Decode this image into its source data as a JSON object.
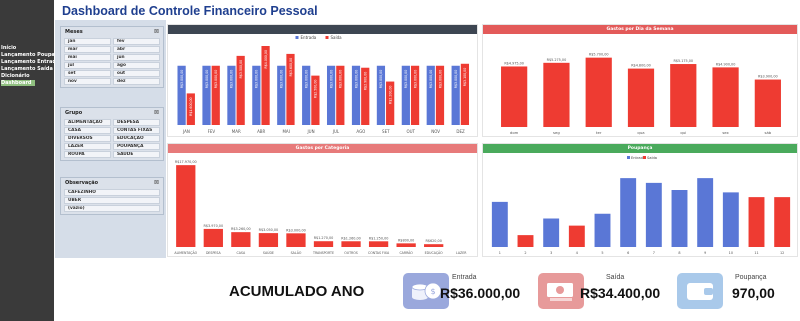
{
  "title": "Dashboard de Controle Financeiro Pessoal",
  "sidebar": {
    "items": [
      {
        "label": "Início",
        "active": false
      },
      {
        "label": "Lançamento Poupança",
        "active": false
      },
      {
        "label": "Lançamento Entrada",
        "active": false
      },
      {
        "label": "Lançamento Saída",
        "active": false
      },
      {
        "label": "Dicionário",
        "active": false
      },
      {
        "label": "Dashboard",
        "active": true
      }
    ]
  },
  "slicers": {
    "mes": {
      "title": "Meses",
      "items": [
        "jan",
        "fev",
        "mar",
        "abr",
        "mai",
        "jun",
        "jul",
        "ago",
        "set",
        "out",
        "nov",
        "dez"
      ]
    },
    "grupo": {
      "title": "Grupo",
      "items": [
        "ALIMENTAÇÃO",
        "DESPESA",
        "CASA",
        "CONTAS FIXAS",
        "DIVERSOS",
        "EDUCAÇÃO",
        "LAZER",
        "POUPANÇA",
        "ROUPA",
        "SAÚDE"
      ]
    },
    "obs": {
      "title": "Observação",
      "items": [
        "CAFEZINHO",
        "UBER",
        "(vazio)"
      ]
    }
  },
  "kpis": {
    "label": "ACUMULADO ANO",
    "entrada": {
      "label": "Entrada",
      "value": "R$36.000,00"
    },
    "saida": {
      "label": "Saída",
      "value": "R$34.400,00"
    },
    "poupanca": {
      "label": "Poupança",
      "value": "970,00"
    }
  },
  "colors": {
    "entrada": "#5a77d6",
    "saida": "#ee3b32",
    "sidebar": "#3a3a3a",
    "title": "#1f3f8f"
  },
  "chart_data": [
    {
      "type": "bar",
      "title": "",
      "legend": [
        "Entrada",
        "Saída"
      ],
      "legend_position": "top",
      "categories": [
        "JAN",
        "FEV",
        "MAR",
        "ABR",
        "MAI",
        "JUN",
        "JUL",
        "AGO",
        "SET",
        "OUT",
        "NOV",
        "DEZ"
      ],
      "series": [
        {
          "name": "Entrada",
          "values": [
            3000,
            3000,
            3000,
            3000,
            3000,
            3000,
            3000,
            3000,
            3000,
            3000,
            3000,
            3000
          ],
          "labels": [
            "R$3.000,00",
            "R$3.000,00",
            "R$3.000,00",
            "R$3.000,00",
            "R$3.000,00",
            "R$3.000,00",
            "R$3.000,00",
            "R$3.000,00",
            "R$3.000,00",
            "R$3.000,00",
            "R$3.000,00",
            "R$3.000,00"
          ]
        },
        {
          "name": "Saída",
          "values": [
            1600,
            3000,
            3500,
            4000,
            3600,
            2500,
            3000,
            2900,
            2200,
            3000,
            3000,
            3100
          ],
          "labels": [
            "R$1.600,00",
            "R$3.000,00",
            "R$3.500,00",
            "R$4.000,00",
            "R$3.600,00",
            "R$2.500,00",
            "R$3.000,00",
            "R$2.900,00",
            "R$2.200,00",
            "R$3.000,00",
            "R$3.000,00",
            "R$3.100,00"
          ]
        }
      ]
    },
    {
      "type": "bar",
      "title": "Gastos por Dia da Semana",
      "categories": [
        "dom",
        "seg",
        "ter",
        "qua",
        "qui",
        "sex",
        "sáb"
      ],
      "series": [
        {
          "name": "",
          "values": [
            4975,
            5275,
            5700,
            4800,
            5175,
            4900,
            3900
          ],
          "labels": [
            "R$4.975,00",
            "R$5.275,00",
            "R$5.700,00",
            "R$4.800,00",
            "R$5.175,00",
            "R$4.900,00",
            "R$3.900,00"
          ]
        }
      ]
    },
    {
      "type": "bar",
      "title": "Gastos por Categoria",
      "categories": [
        "ALIMENTAÇÃO",
        "DESPESA",
        "CASA",
        "SAÚDE",
        "SALÃO",
        "TRANSPORTE",
        "OUTROS",
        "CONTAS FIXA",
        "CARRÃO",
        "EDUCAÇÃO",
        "LAZER"
      ],
      "series": [
        {
          "name": "",
          "values": [
            17970,
            3970,
            3260,
            3050,
            3000,
            1270,
            1260,
            1250,
            800,
            620,
            0
          ],
          "labels": [
            "R$17.970,00",
            "R$3.970,00",
            "R$3.260,00",
            "R$3.050,00",
            "R$3.000,00",
            "R$1.270,00",
            "R$1.260,00",
            "R$1.250,00",
            "R$800,00",
            "R$620,00",
            ""
          ]
        }
      ]
    },
    {
      "type": "bar",
      "title": "Poupança",
      "legend": [
        "Entrada",
        "Saída"
      ],
      "legend_position": "top",
      "categories": [
        "1",
        "2",
        "3",
        "4",
        "5",
        "6",
        "7",
        "8",
        "9",
        "10",
        "11",
        "12"
      ],
      "series": [
        {
          "name": "",
          "values": [
            190,
            50,
            120,
            90,
            140,
            290,
            270,
            240,
            290,
            230,
            210,
            210
          ],
          "colors": [
            "entrada",
            "saida",
            "entrada",
            "saida",
            "entrada",
            "entrada",
            "entrada",
            "entrada",
            "entrada",
            "entrada",
            "saida",
            "saida"
          ]
        }
      ]
    }
  ]
}
